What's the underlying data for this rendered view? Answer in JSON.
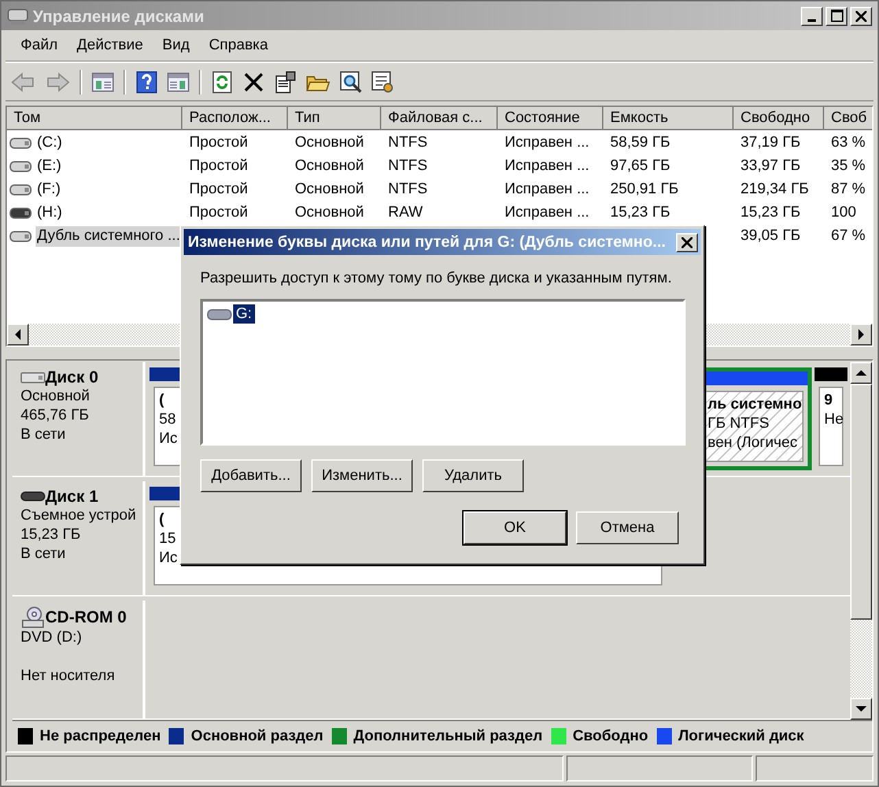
{
  "window": {
    "title": "Управление дисками"
  },
  "menu": [
    "Файл",
    "Действие",
    "Вид",
    "Справка"
  ],
  "volumes": {
    "columns": [
      "Том",
      "Располож...",
      "Тип",
      "Файловая с...",
      "Состояние",
      "Емкость",
      "Свободно",
      "Своб"
    ],
    "rows": [
      {
        "kind": "fixed",
        "selected": false,
        "cells": [
          "(C:)",
          "Простой",
          "Основной",
          "NTFS",
          "Исправен ...",
          "58,59 ГБ",
          "37,19 ГБ",
          "63 %"
        ]
      },
      {
        "kind": "fixed",
        "selected": false,
        "cells": [
          "(E:)",
          "Простой",
          "Основной",
          "NTFS",
          "Исправен ...",
          "97,65 ГБ",
          "33,97 ГБ",
          "35 %"
        ]
      },
      {
        "kind": "fixed",
        "selected": false,
        "cells": [
          "(F:)",
          "Простой",
          "Основной",
          "NTFS",
          "Исправен ...",
          "250,91 ГБ",
          "219,34 ГБ",
          "87 %"
        ]
      },
      {
        "kind": "removable",
        "selected": false,
        "cells": [
          "(H:)",
          "Простой",
          "Основной",
          "RAW",
          "Исправен ...",
          "15,23 ГБ",
          "15,23 ГБ",
          "100"
        ]
      },
      {
        "kind": "fixed",
        "selected": true,
        "cells": [
          "Дубль системного ...",
          null,
          null,
          null,
          null,
          null,
          "39,05 ГБ",
          "67 %"
        ]
      }
    ]
  },
  "disks": [
    {
      "kind": "fixed",
      "name": "Диск 0",
      "type": "Основной",
      "size": "465,76 ГБ",
      "status": "В сети",
      "partitions": [
        {
          "color": "#0a2c8c",
          "extended": false,
          "selected": false,
          "lines": [
            "(",
            "58",
            "Ис"
          ]
        },
        {
          "color": "#1848f0",
          "extended": true,
          "selected": true,
          "lines": [
            "ль системно",
            "ГБ NTFS",
            "вен (Логичес"
          ]
        },
        {
          "color": "#000000",
          "extended": false,
          "selected": false,
          "lines": [
            "9",
            "Не"
          ]
        }
      ]
    },
    {
      "kind": "removable",
      "name": "Диск 1",
      "type": "Съемное устрой",
      "size": "15,23 ГБ",
      "status": "В сети",
      "partitions": [
        {
          "color": "#0a2c8c",
          "extended": false,
          "selected": false,
          "lines": [
            "(",
            "15",
            "Ис"
          ]
        }
      ]
    },
    {
      "kind": "cdrom",
      "name": "CD-ROM 0",
      "type": "DVD (D:)",
      "status": "Нет носителя"
    }
  ],
  "legend": [
    {
      "label": "Не распределен",
      "color": "#000000"
    },
    {
      "label": "Основной раздел",
      "color": "#0a2c8c"
    },
    {
      "label": "Дополнительный раздел",
      "color": "#138a2e"
    },
    {
      "label": "Свободно",
      "color": "#2ee84a"
    },
    {
      "label": "Логический диск",
      "color": "#1848f0"
    }
  ],
  "dialog": {
    "title": "Изменение буквы диска или путей для G: (Дубль системно...",
    "prompt": "Разрешить доступ к этому тому по букве диска и указанным путям.",
    "paths": [
      {
        "label": "G:",
        "selected": true
      }
    ],
    "buttons": [
      "Добавить...",
      "Изменить...",
      "Удалить"
    ],
    "actions": [
      {
        "label": "OK",
        "default": true
      },
      {
        "label": "Отмена",
        "default": false
      }
    ]
  }
}
